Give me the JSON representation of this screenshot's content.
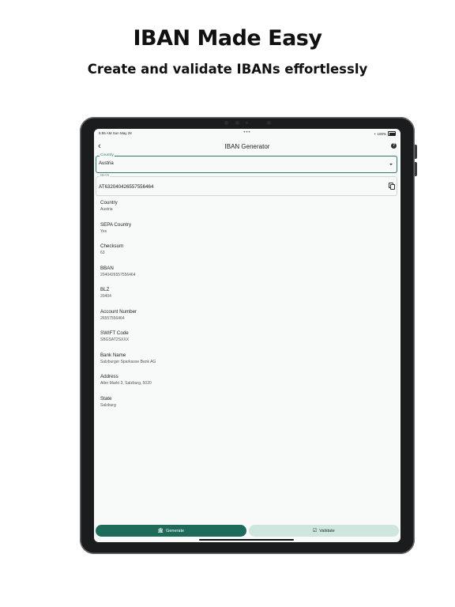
{
  "hero": {
    "title": "IBAN Made Easy",
    "subtitle": "Create and validate IBANs effortlessly"
  },
  "status_bar": {
    "time_date": "5:55 AM  Sun May 28",
    "center_dots": "•••",
    "battery": "100%"
  },
  "nav": {
    "title": "IBAN Generator",
    "back_icon": "chevron-left-icon",
    "help_icon": "help-circle-icon",
    "help_glyph": "?"
  },
  "form": {
    "country_label": "Country",
    "country_value": "Austria",
    "iban_label": "IBAN",
    "iban_value": "AT632040426557556464"
  },
  "details": [
    {
      "key": "Country",
      "value": "Austria"
    },
    {
      "key": "SEPA Country",
      "value": "Yes"
    },
    {
      "key": "Checksum",
      "value": "63"
    },
    {
      "key": "BBAN",
      "value": "2040426557556464"
    },
    {
      "key": "BLZ",
      "value": "20404"
    },
    {
      "key": "Account Number",
      "value": "26557556464"
    },
    {
      "key": "SWIFT Code",
      "value": "SBGSAT2SXXX"
    },
    {
      "key": "Bank Name",
      "value": "Salzburger Sparkasse Bank AG"
    },
    {
      "key": "Address",
      "value": "Alter Markt 3, Salzburg, 5020"
    },
    {
      "key": "State",
      "value": "Salzburg"
    }
  ],
  "bottom_tabs": {
    "generate_label": "Generate",
    "validate_label": "Validate",
    "generate_icon": "bank-icon",
    "validate_icon": "check-card-icon"
  },
  "colors": {
    "accent": "#1e6b5a",
    "accent_light": "#cfe6df",
    "device": "#1b1c1e",
    "screen_bg": "#f7faf8"
  }
}
